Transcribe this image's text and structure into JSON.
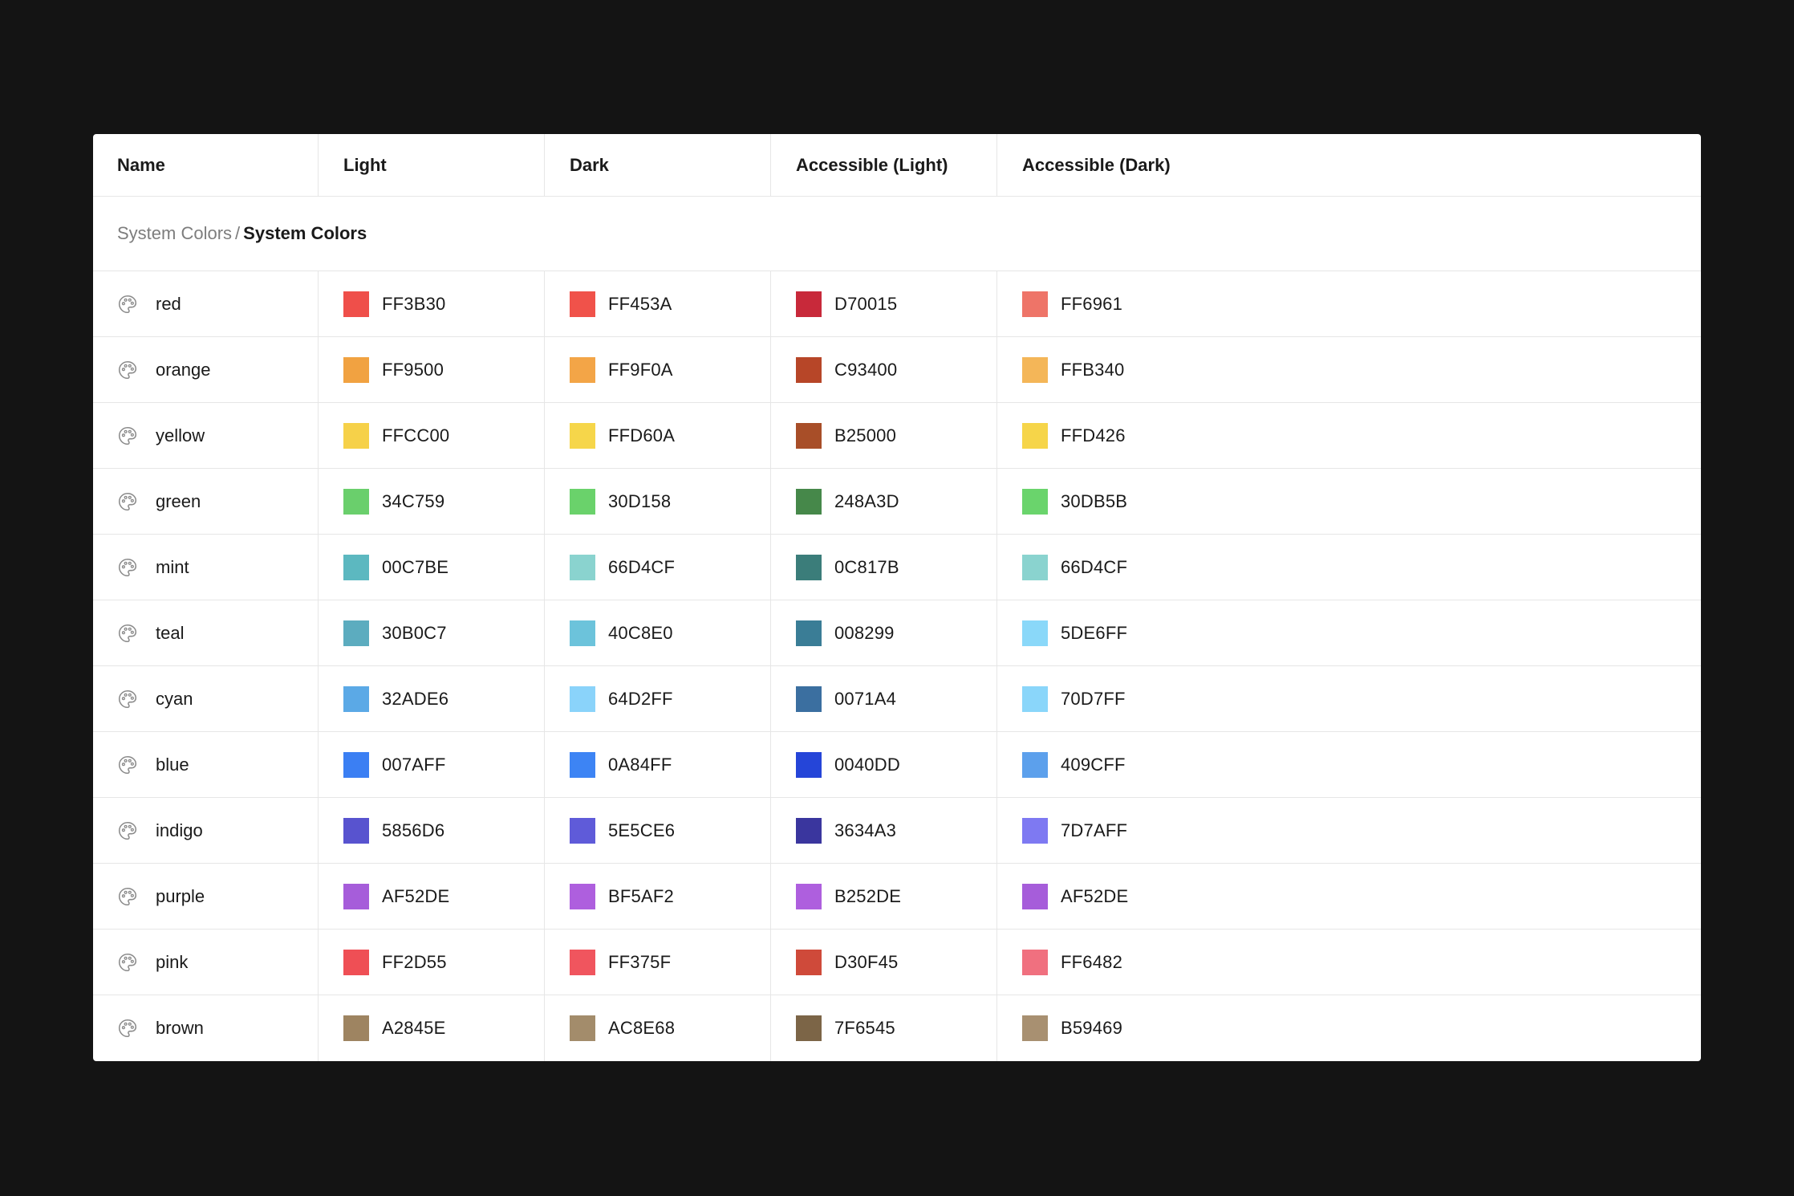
{
  "table": {
    "columns": [
      "Name",
      "Light",
      "Dark",
      "Accessible (Light)",
      "Accessible (Dark)"
    ],
    "group": {
      "parent": "System Colors",
      "separator": "/",
      "current": "System Colors"
    },
    "rows": [
      {
        "name": "red",
        "values": [
          "FF3B30",
          "FF453A",
          "D70015",
          "FF6961"
        ]
      },
      {
        "name": "orange",
        "values": [
          "FF9500",
          "FF9F0A",
          "C93400",
          "FFB340"
        ]
      },
      {
        "name": "yellow",
        "values": [
          "FFCC00",
          "FFD60A",
          "B25000",
          "FFD426"
        ]
      },
      {
        "name": "green",
        "values": [
          "34C759",
          "30D158",
          "248A3D",
          "30DB5B"
        ]
      },
      {
        "name": "mint",
        "values": [
          "00C7BE",
          "66D4CF",
          "0C817B",
          "66D4CF"
        ]
      },
      {
        "name": "teal",
        "values": [
          "30B0C7",
          "40C8E0",
          "008299",
          "5DE6FF"
        ]
      },
      {
        "name": "cyan",
        "values": [
          "32ADE6",
          "64D2FF",
          "0071A4",
          "70D7FF"
        ]
      },
      {
        "name": "blue",
        "values": [
          "007AFF",
          "0A84FF",
          "0040DD",
          "409CFF"
        ]
      },
      {
        "name": "indigo",
        "values": [
          "5856D6",
          "5E5CE6",
          "3634A3",
          "7D7AFF"
        ]
      },
      {
        "name": "purple",
        "values": [
          "AF52DE",
          "BF5AF2",
          "B252DE",
          "AF52DE"
        ]
      },
      {
        "name": "pink",
        "values": [
          "FF2D55",
          "FF375F",
          "D30F45",
          "FF6482"
        ]
      },
      {
        "name": "brown",
        "values": [
          "A2845E",
          "AC8E68",
          "7F6545",
          "B59469"
        ]
      }
    ],
    "swatch_colors": [
      [
        "#EF4F4A",
        "#F0524A",
        "#C8293A",
        "#EE7468"
      ],
      [
        "#F1A241",
        "#F3A547",
        "#B74628",
        "#F4B658"
      ],
      [
        "#F6D149",
        "#F6D64A",
        "#A84E28",
        "#F6D549"
      ],
      [
        "#6ACF6C",
        "#6AD26B",
        "#46884A",
        "#6AD46C"
      ],
      [
        "#5CB8C0",
        "#8AD3CF",
        "#3B7D7A",
        "#8AD3CF"
      ],
      [
        "#5CACBF",
        "#6CC3DB",
        "#3A7D96",
        "#8AD8F9"
      ],
      [
        "#5BA9E6",
        "#8AD3FA",
        "#3B6FA0",
        "#8AD6FA"
      ],
      [
        "#3B7FF3",
        "#3D84F4",
        "#2545D8",
        "#5CA0EC"
      ],
      [
        "#5853CF",
        "#5F5BD9",
        "#3A369E",
        "#7E79F2"
      ],
      [
        "#A65DDA",
        "#AE5FDE",
        "#AE5FDE",
        "#A65DDA"
      ],
      [
        "#EF4F55",
        "#F0555E",
        "#CF4A3A",
        "#F0707F"
      ],
      [
        "#9E8461",
        "#A38C6B",
        "#7C6547",
        "#A89071"
      ]
    ],
    "row_icon": "palette-icon"
  }
}
